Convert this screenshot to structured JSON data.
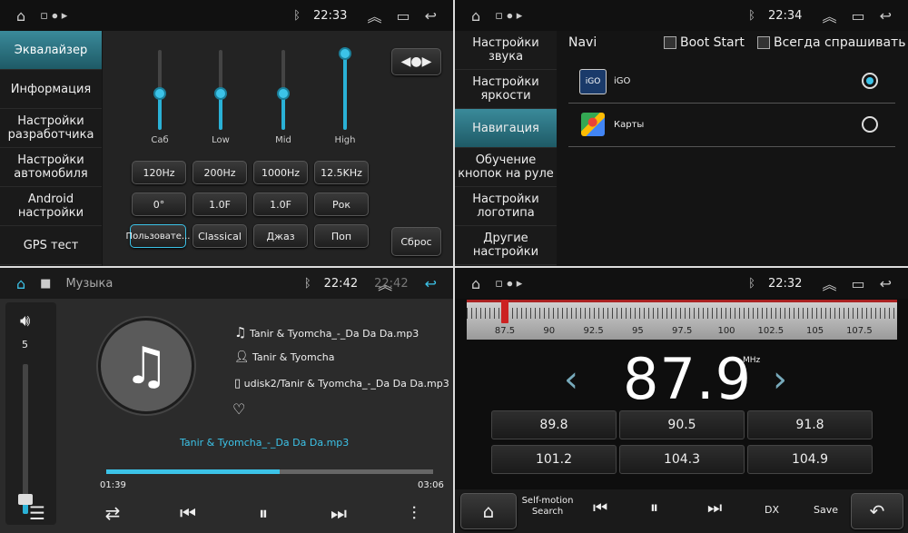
{
  "status": {
    "q1_time": "22:33",
    "q2_time": "22:34",
    "q3_time": "22:42",
    "q3_time_ghost": "22:42",
    "q4_time": "22:32"
  },
  "eq": {
    "menu": [
      "Эквалайзер",
      "Информация",
      "Настройки разработчика",
      "Настройки автомобиля",
      "Android настройки",
      "GPS тест"
    ],
    "bands": [
      {
        "label": "Саб",
        "level": 0.45
      },
      {
        "label": "Low",
        "level": 0.45
      },
      {
        "label": "Mid",
        "level": 0.45
      },
      {
        "label": "High",
        "level": 0.95
      }
    ],
    "row1": [
      "120Hz",
      "200Hz",
      "1000Hz",
      "12.5KHz"
    ],
    "row2": [
      "0°",
      "1.0F",
      "1.0F",
      "Рок"
    ],
    "row3": [
      "Пользовате...",
      "Classical",
      "Джаз",
      "Поп"
    ],
    "reset": "Сброс"
  },
  "nav": {
    "menu": [
      "Настройки звука",
      "Настройки яркости",
      "Навигация",
      "Обучение кнопок на руле",
      "Настройки логотипа",
      "Другие настройки"
    ],
    "title": "Navi",
    "boot_start": "Boot Start",
    "always_ask": "Всегда спрашивать",
    "apps": [
      {
        "name": "iGO",
        "selected": true
      },
      {
        "name": "Карты",
        "selected": false
      }
    ],
    "igo_logo": "iGO"
  },
  "music": {
    "title": "Музыка",
    "volume": "5",
    "volume_level": 0.1,
    "file": "Tanir & Tyomcha_-_Da Da Da.mp3",
    "artist": "Tanir & Tyomcha",
    "path": "udisk2/Tanir & Tyomcha_-_Da Da Da.mp3",
    "now_playing": "Tanir & Tyomcha_-_Da Da Da.mp3",
    "elapsed": "01:39",
    "total": "03:06",
    "progress": 0.53
  },
  "radio": {
    "ticks": [
      "87.5",
      "90",
      "92.5",
      "95",
      "97.5",
      "100",
      "102.5",
      "105",
      "107.5"
    ],
    "freq": "87.9",
    "unit": "MHz",
    "presets": [
      "89.8",
      "90.5",
      "91.8",
      "101.2",
      "104.3",
      "104.9"
    ],
    "self_motion": "Self-motion",
    "search": "Search",
    "dx": "DX",
    "save": "Save"
  },
  "colors": {
    "accent": "#2ab1d6",
    "menu_active": "#2b7785"
  }
}
